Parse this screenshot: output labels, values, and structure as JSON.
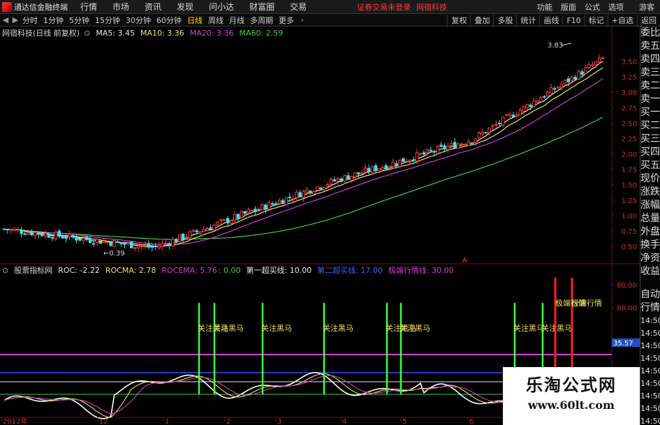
{
  "app": {
    "title": "通达信金融终端"
  },
  "menu": {
    "items": [
      "行情",
      "市场",
      "资讯",
      "发现",
      "问小达",
      "财富圈",
      "交易"
    ],
    "alert": "证券交易未登录",
    "alert_stock": "网宿科技",
    "right_items": [
      "功能",
      "版面",
      "公式",
      "选项",
      "游客"
    ]
  },
  "toolbar": {
    "periods": [
      "分时",
      "1分钟",
      "5分钟",
      "15分钟",
      "30分钟",
      "60分钟",
      "日线",
      "周线",
      "月线",
      "多周期",
      "更多"
    ],
    "active_period": "日线",
    "right_items": [
      "复权",
      "叠加",
      "多股",
      "统计",
      "画线",
      "F10",
      "标记",
      "+自选",
      "返回"
    ]
  },
  "main_chart": {
    "stock_label": "网宿科技(日线 前复权)",
    "ma": [
      {
        "label": "MA5: 3.45",
        "color": "#e8e8e8"
      },
      {
        "label": "MA10: 3.36",
        "color": "#f0e060"
      },
      {
        "label": "MA20: 3.36",
        "color": "#d040d0"
      },
      {
        "label": "MA60: 2.59",
        "color": "#40d040"
      }
    ],
    "high_label": "3.83",
    "low_label": "0.39",
    "y_ticks": [
      "3.50",
      "3.25",
      "3.00",
      "2.75",
      "2.50",
      "2.25",
      "2.00",
      "1.75",
      "1.50",
      "1.25",
      "1.00",
      "0.75",
      "0.50"
    ],
    "marker": "A"
  },
  "indicator": {
    "name": "股票指标网",
    "items": [
      {
        "label": "ROC: -2.22",
        "color": "#e8e8e8"
      },
      {
        "label": "ROCMA: 2.78",
        "color": "#f0e060"
      },
      {
        "label": "ROCEMA: 5.76",
        "color": "#d040d0"
      },
      {
        "label": ": 0.00",
        "color": "#40d040"
      },
      {
        "label": "第一超买线: 10.00",
        "color": "#e8e8e8"
      },
      {
        "label": "第二超买线: 17.00",
        "color": "#4060ff"
      },
      {
        "label": "极端行情线: 30.00",
        "color": "#d040d0"
      }
    ],
    "signals": [
      "关注黑马",
      "关注黑马",
      "关注黑马",
      "关注黑马",
      "关注黑马",
      "关注黑马",
      "关注黑马",
      "关注黑马"
    ],
    "extreme_label": "极端行情",
    "current_value": "35.57",
    "y_ticks": [
      "80.00",
      "60.00"
    ]
  },
  "time_axis": [
    "2012年",
    "12",
    "1",
    "2",
    "3",
    "4",
    "5",
    "6"
  ],
  "right_panel": {
    "items": [
      "委比",
      "卖五",
      "卖四",
      "卖三",
      "卖二",
      "卖一",
      "买一",
      "买二",
      "买三",
      "买四",
      "买五",
      "现价",
      "涨跌",
      "涨幅",
      "总量",
      "外盘",
      "换手",
      "净资",
      "收益",
      "自动",
      "行情"
    ],
    "times": [
      "14:50",
      "14:50",
      "14:50",
      "14:50",
      "14:50",
      "14:50",
      "14:50",
      "14:50",
      "14:50"
    ]
  },
  "watermark": {
    "title": "乐淘公式网",
    "url": "www.60lt.com"
  },
  "colors": {
    "up": "#ff3c3c",
    "down": "#40e0f0",
    "ma5": "#e8e8e8",
    "ma10": "#f0e060",
    "ma20": "#d040d0",
    "ma60": "#40d040",
    "signal": "#40ff40",
    "extreme": "#ff2020"
  }
}
